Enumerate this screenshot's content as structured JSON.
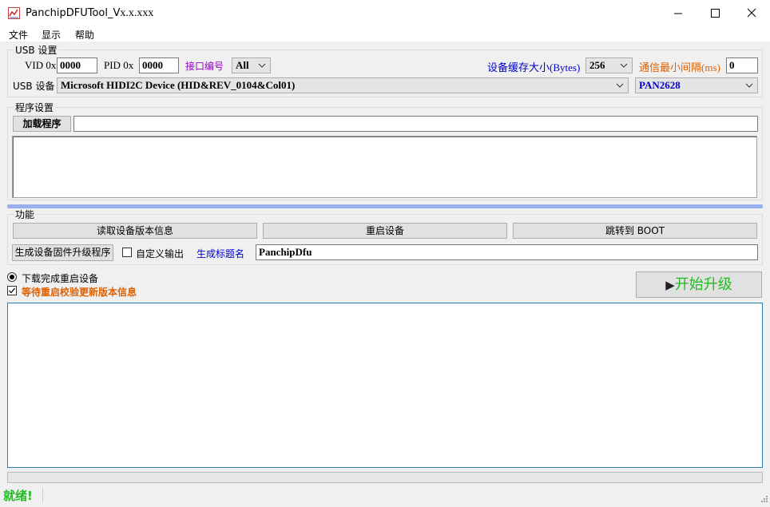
{
  "window": {
    "title_main": "PanchipDFUTool_V",
    "title_version": "x.x.xxx",
    "minimize": "─",
    "maximize": "☐",
    "close": "✕"
  },
  "menu": [
    "文件",
    "显示",
    "帮助"
  ],
  "usb": {
    "group_label": "USB 设置",
    "vid_label": "VID 0x",
    "vid_value": "0000",
    "pid_label": "PID 0x",
    "pid_value": "0000",
    "port_label": "接口编号",
    "port_value": "All",
    "buffer_label": "设备缓存大小(Bytes)",
    "buffer_value": "256",
    "interval_label": "通信最小间隔(ms)",
    "interval_value": "0",
    "device_label": "USB 设备",
    "device_value": "Microsoft HIDI2C Device (HID&REV_0104&Col01)",
    "chip_value": "PAN2628"
  },
  "program": {
    "group_label": "程序设置",
    "load_button": "加载程序",
    "path_value": ""
  },
  "functions": {
    "group_label": "功能",
    "read_version": "读取设备版本信息",
    "restart": "重启设备",
    "jump_boot": "跳转到 BOOT",
    "generate": "生成设备固件升级程序",
    "custom_output": "自定义输出",
    "title_label": "生成标题名",
    "title_value": "PanchipDfu"
  },
  "options": {
    "radio_label": "下载完成重启设备",
    "check_label": "等待重启校验更新版本信息"
  },
  "start_button": "开始升级",
  "status": {
    "text": "就绪!"
  },
  "colors": {
    "blue_label": "#0000cc",
    "purple_label": "#9900cc",
    "orange_label": "#e06000",
    "green": "#22bb22",
    "separator": "#9ab0ee",
    "log_border": "#2a7fb0"
  }
}
